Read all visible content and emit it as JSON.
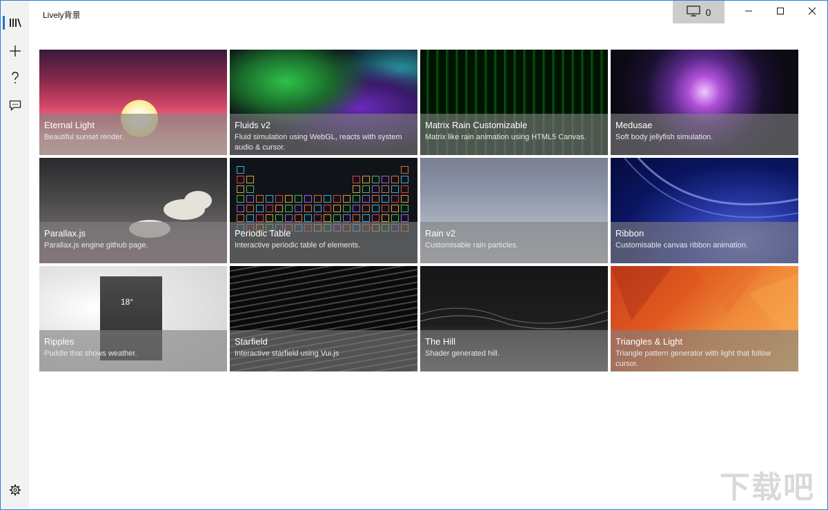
{
  "app": {
    "title": "Lively背景"
  },
  "sidebar": {
    "items": [
      {
        "name": "library",
        "icon": "library-icon"
      },
      {
        "name": "add",
        "icon": "plus-icon"
      },
      {
        "name": "help",
        "icon": "question-icon"
      },
      {
        "name": "feedback",
        "icon": "feedback-icon"
      },
      {
        "name": "settings",
        "icon": "gear-icon"
      }
    ],
    "active": "library"
  },
  "titlebar": {
    "screen_count": "0",
    "screen_icon": "monitor-icon",
    "controls": [
      "minimize-icon",
      "maximize-icon",
      "close-icon"
    ]
  },
  "wallpapers": [
    {
      "title": "Eternal Light",
      "desc": "Beautiful sunset render."
    },
    {
      "title": "Fluids v2",
      "desc": "Fluid simulation using WebGL, reacts with system audio & cursor."
    },
    {
      "title": "Matrix Rain Customizable",
      "desc": "Matrix like rain animation using HTML5 Canvas."
    },
    {
      "title": "Medusae",
      "desc": "Soft body jellyfish simulation."
    },
    {
      "title": "Parallax.js",
      "desc": "Parallax.js engine github page."
    },
    {
      "title": "Periodic Table",
      "desc": "Interactive periodic table of elements."
    },
    {
      "title": "Rain v2",
      "desc": "Customisable rain particles."
    },
    {
      "title": "Ribbon",
      "desc": "Customisable canvas ribbon animation."
    },
    {
      "title": "Ripples",
      "desc": "Puddle that shows weather."
    },
    {
      "title": "Starfield",
      "desc": "Interactive starfield using Vui.js"
    },
    {
      "title": "The Hill",
      "desc": "Shader generated hill."
    },
    {
      "title": "Triangles & Light",
      "desc": "Triangle pattern generator with light that follow cursor."
    }
  ],
  "ripples_card": {
    "temperature": "18°"
  },
  "watermark": "下载吧",
  "colors": {
    "accent": "#1a73c9",
    "sidebar_bg": "#f2f2f2",
    "screen_btn_bg": "#cccccc",
    "caption_bg": "#808080"
  }
}
